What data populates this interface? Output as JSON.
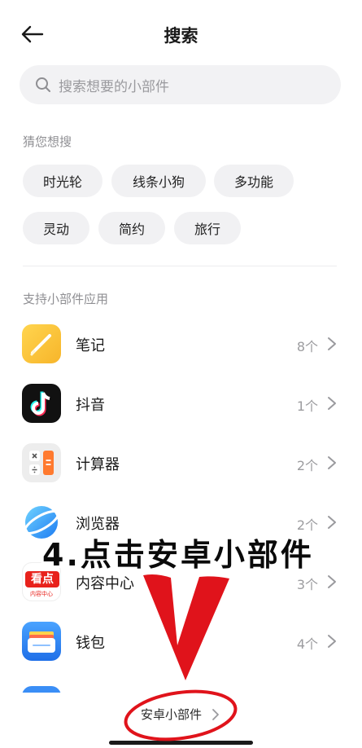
{
  "header": {
    "title": "搜索",
    "back_icon": "arrow-left-icon"
  },
  "search": {
    "placeholder": "搜索想要的小部件",
    "icon": "search-icon"
  },
  "suggestions": {
    "label": "猜您想搜",
    "chips": [
      "时光轮",
      "线条小狗",
      "多功能",
      "灵动",
      "简约",
      "旅行"
    ]
  },
  "apps": {
    "label": "支持小部件应用",
    "items": [
      {
        "name": "笔记",
        "count": "8个",
        "icon": "notes-icon"
      },
      {
        "name": "抖音",
        "count": "1个",
        "icon": "douyin-icon"
      },
      {
        "name": "计算器",
        "count": "2个",
        "icon": "calculator-icon"
      },
      {
        "name": "浏览器",
        "count": "2个",
        "icon": "browser-icon"
      },
      {
        "name": "内容中心",
        "count": "3个",
        "icon": "content-center-icon",
        "icon_text": "看点",
        "icon_subtext": "内容中心"
      },
      {
        "name": "钱包",
        "count": "4个",
        "icon": "wallet-icon"
      }
    ]
  },
  "bottom": {
    "label": "安卓小部件"
  },
  "annotation": {
    "text": "4.点击安卓小部件",
    "color": "#e0131b"
  }
}
